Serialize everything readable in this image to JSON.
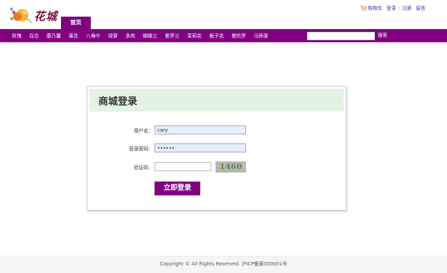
{
  "header": {
    "logo_text": "花城",
    "home_tab": "首页",
    "top_links": {
      "cart": "购物车",
      "login": "登录",
      "separator": "|",
      "register": "注册",
      "message": "留言"
    }
  },
  "nav": {
    "items": [
      "玫瑰",
      "百合",
      "康乃馨",
      "菊花",
      "八角叶",
      "绿萝",
      "多肉",
      "蝴蝶兰",
      "紫罗兰",
      "茉莉花",
      "栀子花",
      "曼陀罗",
      "马蹄莲"
    ],
    "search_value": "",
    "search_button": "搜索"
  },
  "login": {
    "title": "商城登录",
    "username_label": "用户名：",
    "username_value": "cary",
    "password_label": "登录密码：",
    "password_value": "••••••",
    "captcha_label": "验证码：",
    "captcha_value": "",
    "captcha_image_text": "1460",
    "submit_label": "立即登录"
  },
  "footer": {
    "copyright": "Copyright © All Rights Reserved. 沪ICP备案000001号"
  },
  "colors": {
    "brand": "#800080",
    "title_bar": "#e2f3e3",
    "input_fill": "#e8eefc",
    "footer_bg": "#f5f5f5"
  }
}
